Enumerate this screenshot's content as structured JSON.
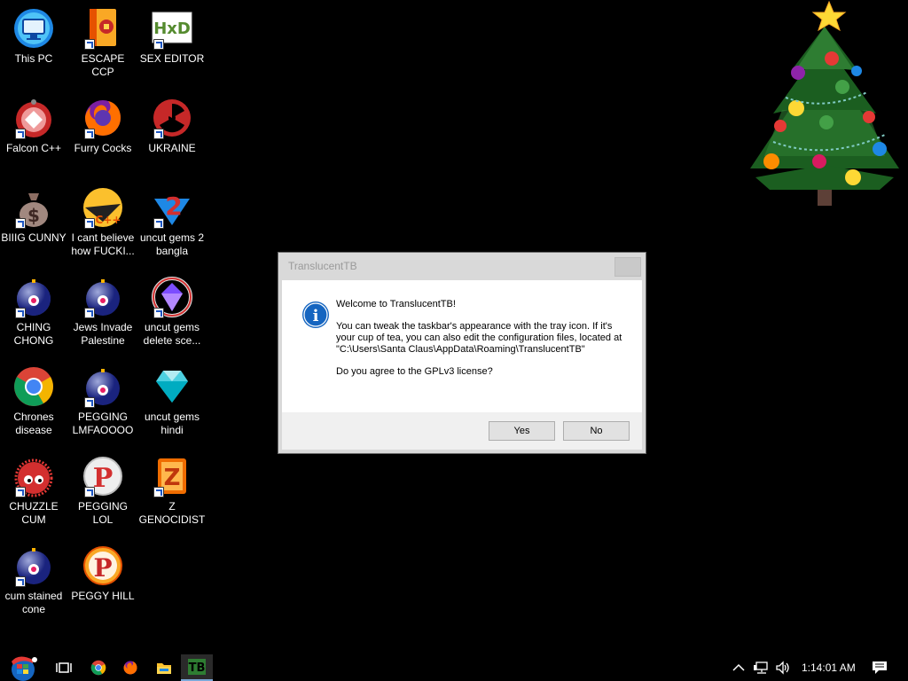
{
  "desktop": {
    "icons": [
      {
        "label": "This PC"
      },
      {
        "label": "ESCAPE CCP"
      },
      {
        "label": "SEX EDITOR"
      },
      {
        "label": "Falcon C++"
      },
      {
        "label": "Furry Cocks"
      },
      {
        "label": "UKRAINE"
      },
      {
        "label": "BIIIG CUNNY"
      },
      {
        "label": "I cant believe how FUCKI..."
      },
      {
        "label": "uncut gems 2 bangla"
      },
      {
        "label": "CHING CHONG"
      },
      {
        "label": "Jews Invade Palestine"
      },
      {
        "label": "uncut gems delete sce..."
      },
      {
        "label": "Chrones disease"
      },
      {
        "label": "PEGGING LMFAOOOO"
      },
      {
        "label": "uncut gems hindi"
      },
      {
        "label": "CHUZZLE CUM"
      },
      {
        "label": "PEGGING LOL"
      },
      {
        "label": "Z GENOCIDIST"
      },
      {
        "label": "cum stained cone"
      },
      {
        "label": "PEGGY HILL"
      }
    ],
    "icon_glyphs": {
      "hxd": "HxD",
      "dollar": "$",
      "cpp": "C++",
      "two": "2",
      "peggle": "P",
      "zuma": "Z"
    }
  },
  "dialog": {
    "title": "TranslucentTB",
    "heading": "Welcome to TranslucentTB!",
    "body": "You can tweak the taskbar's appearance with the tray icon. If it's your cup of tea, you can also edit the configuration files, located at \"C:\\Users\\Santa Claus\\AppData\\Roaming\\TranslucentTB\"",
    "question": "Do you agree to the GPLv3 license?",
    "yes_label": "Yes",
    "no_label": "No",
    "icon_glyph": "i"
  },
  "taskbar": {
    "apps": [
      "start-orb",
      "task-view",
      "chrome",
      "firefox",
      "file-explorer",
      "translucenttb"
    ],
    "active_app_glyph": "TB",
    "clock": "1:14:01 AM"
  },
  "colors": {
    "desktop_bg": "#000000",
    "dialog_bg": "#d9d9d9",
    "button_bg": "#e1e1e1",
    "info_blue": "#1565c0"
  }
}
